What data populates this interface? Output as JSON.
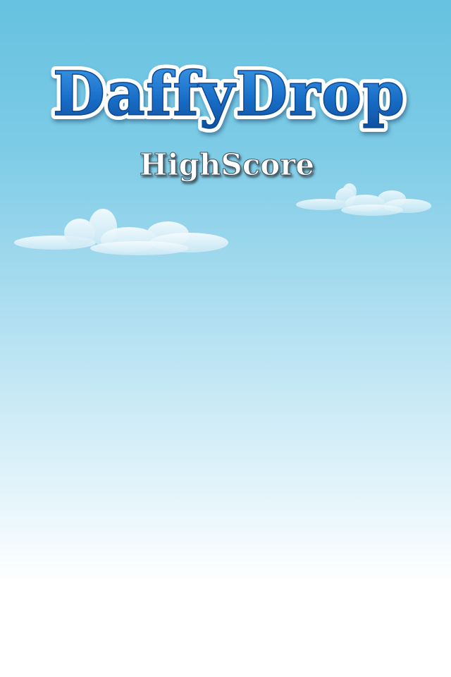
{
  "header": {
    "game_title": "DaffyDrop",
    "screen_title": "HighScore"
  },
  "colors": {
    "sky_top": "#65c2e0",
    "sky_bottom": "#ffffff",
    "title_blue": "#1a6fc9",
    "title_outline": "#ffffff",
    "subtitle_fill": "#ffffff",
    "subtitle_shadow": "#3a4a55",
    "cloud_fill": "#e6f5fb"
  },
  "scenery": {
    "clouds": [
      "cloud-left",
      "cloud-right"
    ]
  }
}
